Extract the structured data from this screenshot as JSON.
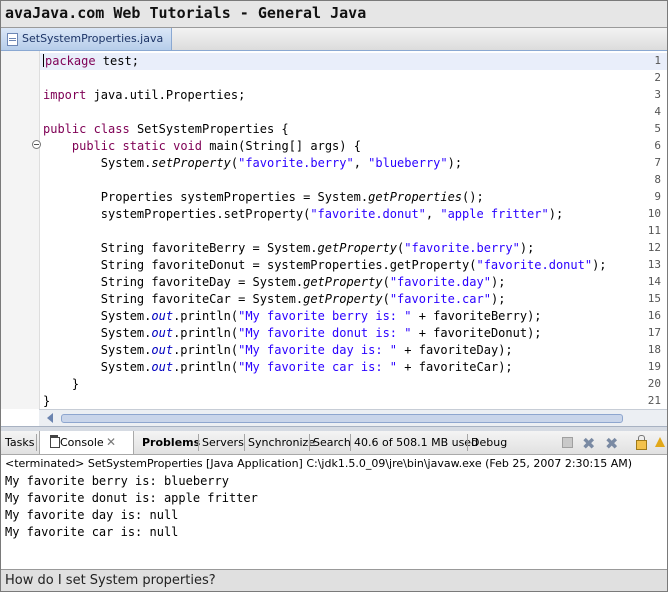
{
  "title": "avaJava.com Web Tutorials - General Java",
  "editor": {
    "tab_label": "SetSystemProperties.java",
    "line_numbers": [
      "1",
      "2",
      "3",
      "4",
      "5",
      "6",
      "7",
      "8",
      "9",
      "10",
      "11",
      "12",
      "13",
      "14",
      "15",
      "16",
      "17",
      "18",
      "19",
      "20",
      "21"
    ],
    "lines": [
      {
        "k": "package"
      },
      {},
      {
        "k": "import",
        "t": " java.util.Properties;"
      },
      {},
      {
        "k": "public",
        "k2": "class",
        "t": " SetSystemProperties {"
      },
      {
        "k": "public",
        "k2": "static",
        "k3": "void",
        "t": " main(String[] args) {"
      },
      {
        "a": "System.",
        "m": "setProperty",
        "b": "(",
        "s1": "\"favorite.berry\"",
        "c": ", ",
        "s2": "\"blueberry\"",
        "d": ");"
      },
      {},
      {
        "a": "Properties systemProperties = System.",
        "m": "getProperties",
        "b": "();"
      },
      {
        "a": "systemProperties.setProperty(",
        "s1": "\"favorite.donut\"",
        "c": ", ",
        "s2": "\"apple fritter\"",
        "d": ");"
      },
      {},
      {
        "a": "String favoriteBerry = System.",
        "m": "getProperty",
        "b": "(",
        "s1": "\"favorite.berry\"",
        "d": ");"
      },
      {
        "a": "String favoriteDonut = systemProperties.getProperty(",
        "s1": "\"favorite.donut\"",
        "d": ");"
      },
      {
        "a": "String favoriteDay = System.",
        "m": "getProperty",
        "b": "(",
        "s1": "\"favorite.day\"",
        "d": ");"
      },
      {
        "a": "String favoriteCar = System.",
        "m": "getProperty",
        "b": "(",
        "s1": "\"favorite.car\"",
        "d": ");"
      },
      {
        "a": "System.",
        "f": "out",
        "b": ".println(",
        "s1": "\"My favorite berry is: \"",
        "d": " + favoriteBerry);"
      },
      {
        "a": "System.",
        "f": "out",
        "b": ".println(",
        "s1": "\"My favorite donut is: \"",
        "d": " + favoriteDonut);"
      },
      {
        "a": "System.",
        "f": "out",
        "b": ".println(",
        "s1": "\"My favorite day is: \"",
        "d": " + favoriteDay);"
      },
      {
        "a": "System.",
        "f": "out",
        "b": ".println(",
        "s1": "\"My favorite car is: \"",
        "d": " + favoriteCar);"
      },
      {
        "a": "}"
      },
      {
        "a": "}"
      }
    ],
    "package_rest": " test;"
  },
  "views": {
    "tasks": "Tasks",
    "console": "Console",
    "console_close": "✕",
    "problems": "Problems",
    "servers": "Servers",
    "synchronize": "Synchronize",
    "search": "Search",
    "memory": "40.6 of 508.1 MB used",
    "debug": "Debug"
  },
  "console": {
    "status": "<terminated> SetSystemProperties [Java Application] C:\\jdk1.5.0_09\\jre\\bin\\javaw.exe (Feb 25, 2007 2:30:15 AM)",
    "output": [
      "My favorite berry is: blueberry",
      "My favorite donut is: apple fritter",
      "My favorite day is: null",
      "My favorite car is: null"
    ]
  },
  "footer": {
    "question": "How do I set System properties?"
  },
  "icons": {
    "remove": "✖",
    "remove_all": "✖"
  }
}
